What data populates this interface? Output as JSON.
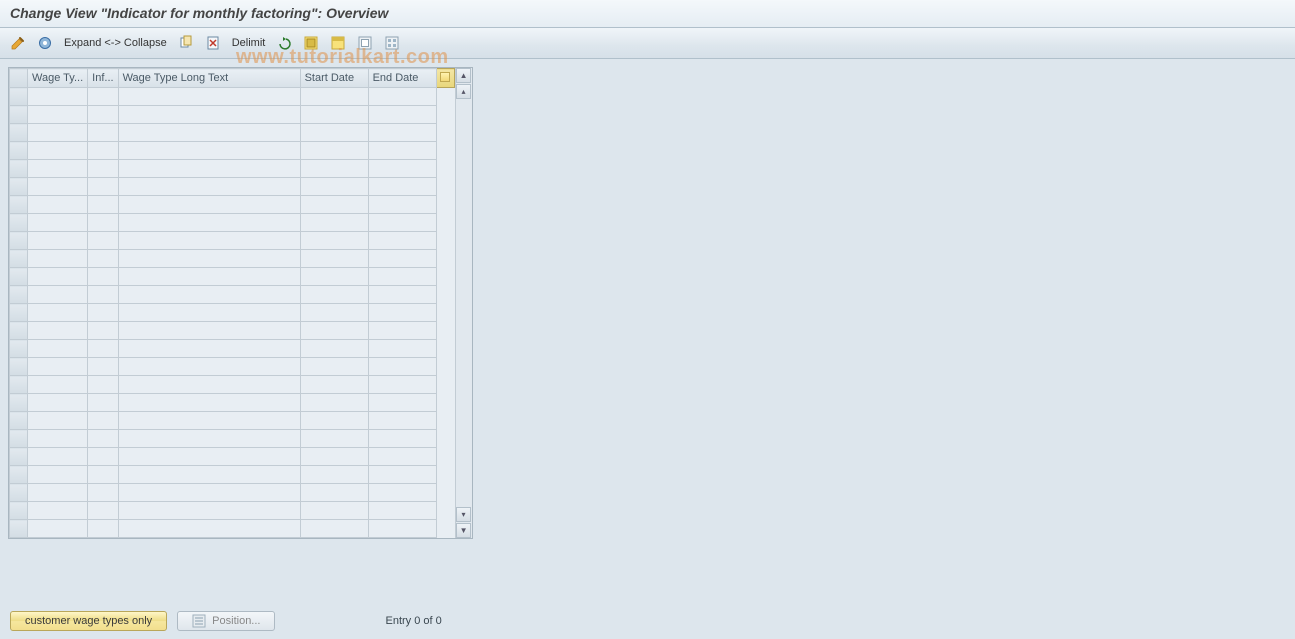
{
  "title": "Change View \"Indicator for monthly factoring\": Overview",
  "toolbar": {
    "expand_collapse": "Expand <-> Collapse",
    "delimit": "Delimit"
  },
  "columns": {
    "wage_type": "Wage Ty...",
    "inf": "Inf...",
    "long_text": "Wage Type Long Text",
    "start_date": "Start Date",
    "end_date": "End Date"
  },
  "rows": [
    {},
    {},
    {},
    {},
    {},
    {},
    {},
    {},
    {},
    {},
    {},
    {},
    {},
    {},
    {},
    {},
    {},
    {},
    {},
    {},
    {},
    {},
    {},
    {},
    {}
  ],
  "footer": {
    "customer_btn": "customer wage types only",
    "position_btn": "Position...",
    "entry_text": "Entry 0 of 0"
  },
  "watermark": "www.tutorialkart.com"
}
